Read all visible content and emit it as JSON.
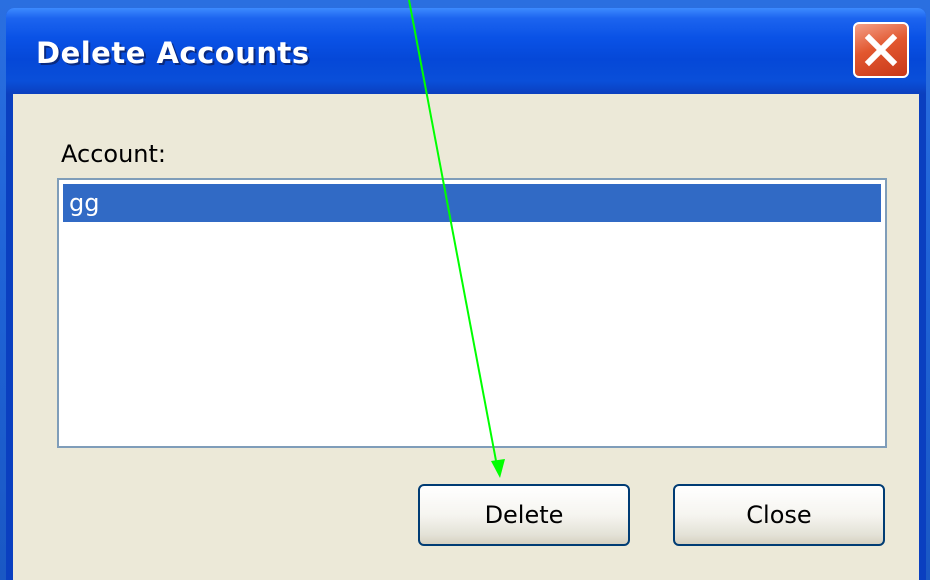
{
  "window": {
    "title": "Delete Accounts"
  },
  "dialog": {
    "account_label": "Account:",
    "accounts": [
      "gg"
    ],
    "selected_account": "gg",
    "delete_label": "Delete",
    "close_label": "Close"
  },
  "colors": {
    "titlebar": "#0a52e6",
    "selection": "#316ac5",
    "close_button": "#e2572f",
    "annotation_arrow": "#00ff00",
    "client_background": "#ece9d8"
  },
  "icons": {
    "close": "close-x-icon",
    "annotation": "arrow-pointer-icon"
  }
}
